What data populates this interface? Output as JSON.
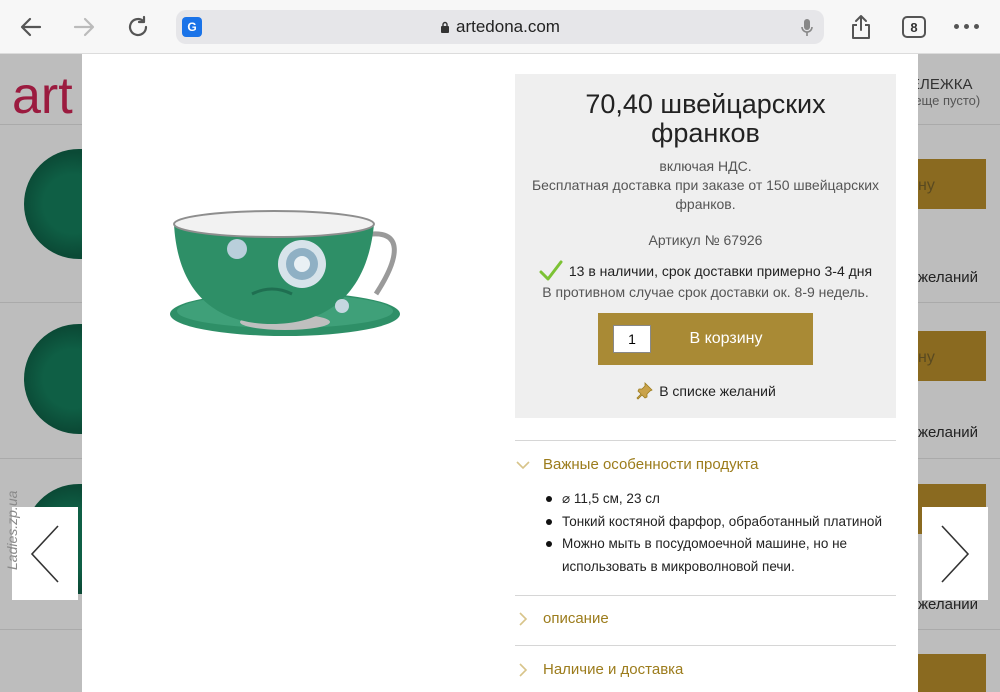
{
  "browser": {
    "url": "artedona.com",
    "tab_count": "8"
  },
  "background": {
    "logo": "art",
    "cart_label": "ЕЛЕЖКА",
    "cart_status": "(еще пусто)",
    "button_fragment": "ну",
    "wishlist_fragment": "желаний"
  },
  "product": {
    "price": "70,40 швейцарских франков",
    "vat": "включая НДС.",
    "shipping": "Бесплатная доставка при заказе от 150 швейцарских франков.",
    "article": "Артикул № 67926",
    "stock": "13 в наличии, срок доставки примерно 3-4 дня",
    "stock_alt": "В противном случае срок доставки ок. 8-9 недель.",
    "quantity": "1",
    "cart_button": "В корзину",
    "wishlist": "В списке желаний"
  },
  "accordion": {
    "features_title": "Важные особенности продукта",
    "features": [
      "⌀ 11,5 см, 23 сл",
      "Тонкий костяной фарфор, обработанный платиной",
      "Можно мыть в посудомоечной машине, но не использовать в микроволновой печи."
    ],
    "description_title": "описание",
    "availability_title": "Наличие и доставка"
  },
  "watermark": "Ladies.zp.ua",
  "colors": {
    "gold": "#a98a35",
    "accent_text": "#9c7c1c",
    "check": "#7cc234",
    "logo": "#9b1b3f",
    "cup_green": "#2e8f67"
  },
  "icons": [
    "back-arrow-icon",
    "forward-arrow-icon",
    "reload-icon",
    "translate-icon",
    "lock-icon",
    "microphone-icon",
    "share-icon",
    "more-icon",
    "checkmark-icon",
    "pin-icon",
    "chevron-down-icon",
    "chevron-right-icon"
  ]
}
